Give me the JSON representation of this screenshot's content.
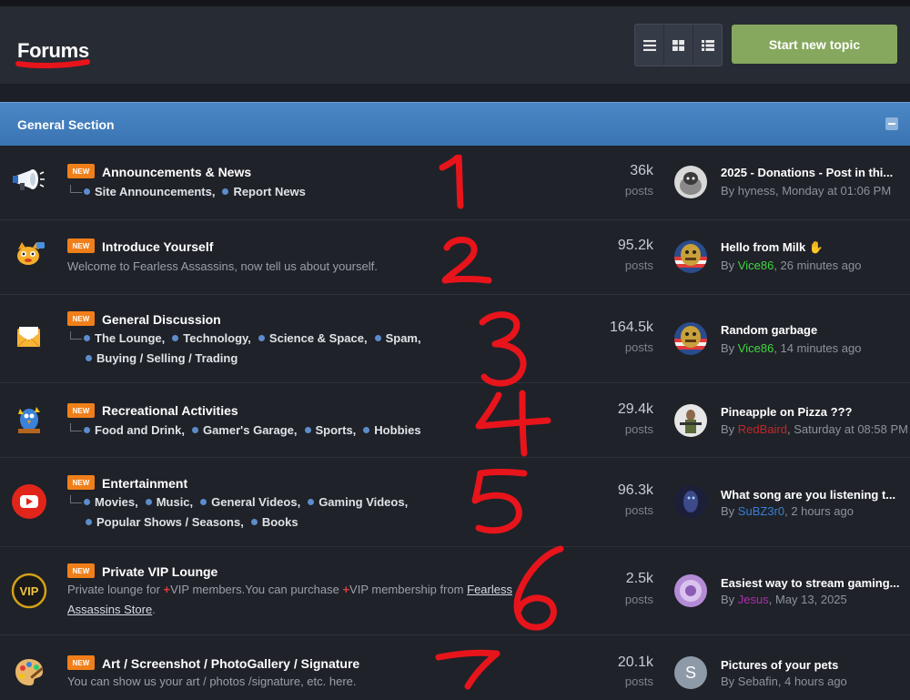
{
  "header": {
    "title": "Forums",
    "start_label": "Start new topic"
  },
  "view_buttons": [
    "list-view-icon",
    "grid-view-icon",
    "table-view-icon"
  ],
  "section": {
    "title": "General Section"
  },
  "badge_label": "NEW",
  "posts_label": "posts",
  "forums": [
    {
      "name": "Announcements & News",
      "icon": "megaphone-icon",
      "subforums": [
        "Site Announcements,",
        "Report News"
      ],
      "count": "36k",
      "last": {
        "title": "2025 - Donations - Post in thi...",
        "by": "By ",
        "user": "hyness",
        "time": ", Monday at 01:06 PM"
      }
    },
    {
      "name": "Introduce Yourself",
      "icon": "cat-icon",
      "desc": "Welcome to Fearless Assassins, now tell us about yourself.",
      "count": "95.2k",
      "last": {
        "title": "Hello from Milk",
        "by": "By ",
        "user": "Vice86",
        "time": ", 26 minutes ago"
      }
    },
    {
      "name": "General Discussion",
      "icon": "envelope-icon",
      "subforums": [
        "The Lounge,",
        "Technology,",
        "Science & Space,",
        "Spam,",
        "Buying / Selling / Trading"
      ],
      "count": "164.5k",
      "last": {
        "title": "Random garbage",
        "by": "By ",
        "user": "Vice86",
        "time": ", 14 minutes ago"
      }
    },
    {
      "name": "Recreational Activities",
      "icon": "bird-icon",
      "subforums": [
        "Food and Drink,",
        "Gamer's Garage,",
        "Sports,",
        "Hobbies"
      ],
      "count": "29.4k",
      "last": {
        "title": "Pineapple on Pizza ???",
        "by": "By ",
        "user": "RedBaird",
        "time": ", Saturday at 08:58 PM"
      }
    },
    {
      "name": "Entertainment",
      "icon": "youtube-icon",
      "subforums": [
        "Movies,",
        "Music,",
        "General Videos,",
        "Gaming Videos,",
        "Popular Shows / Seasons,",
        "Books"
      ],
      "count": "96.3k",
      "last": {
        "title": "What song are you listening t...",
        "by": "By ",
        "user": "SuBZ3r0",
        "time": ", 2 hours ago"
      }
    },
    {
      "name": "Private VIP Lounge",
      "icon": "vip-icon",
      "desc_parts": {
        "a": "Private lounge for ",
        "plus1": "+",
        "b": "VIP members.You can purchase ",
        "plus2": "+",
        "c": "VIP membership from ",
        "link": "Fearless Assassins Store",
        "d": "."
      },
      "count": "2.5k",
      "last": {
        "title": "Easiest way to stream gaming...",
        "by": "By ",
        "user": "Jesus",
        "time": ", May 13, 2025"
      }
    },
    {
      "name": "Art / Screenshot / PhotoGallery / Signature",
      "icon": "palette-icon",
      "desc": "You can show us your art / photos /signature, etc. here.",
      "count": "20.1k",
      "last": {
        "title": "Pictures of your pets",
        "by": "By ",
        "user": "Sebafin",
        "time": ", 4 hours ago",
        "avatar_letter": "S"
      }
    }
  ],
  "annotations": [
    "1",
    "2",
    "3",
    "4",
    "5",
    "6",
    "7"
  ],
  "colors": {
    "accent": "#4b87c5",
    "start_button": "#86a85e",
    "badge": "#f07f1a",
    "annotation": "#e8141b"
  }
}
